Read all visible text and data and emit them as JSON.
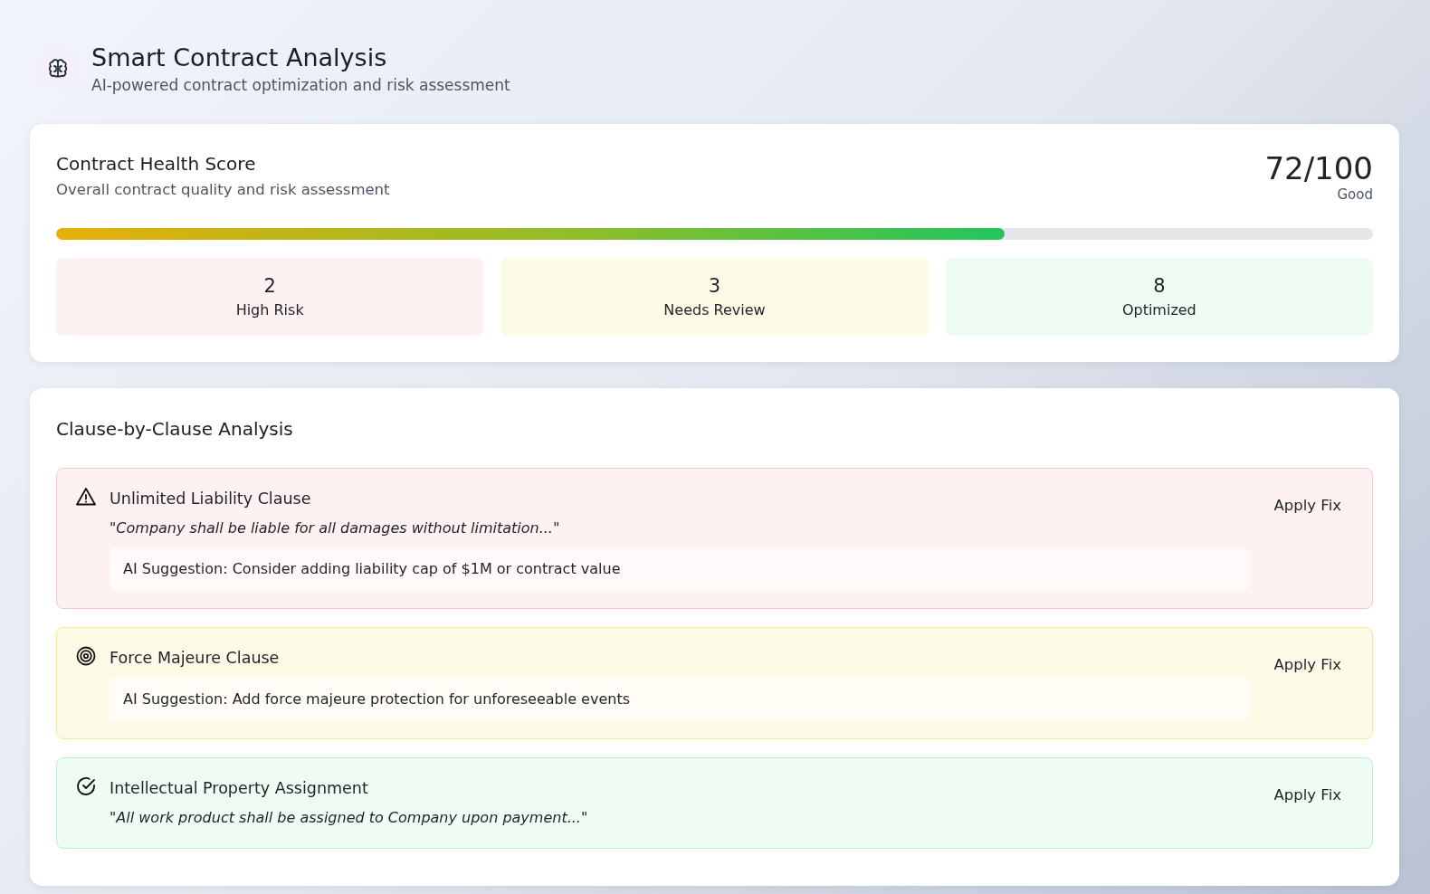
{
  "header": {
    "title": "Smart Contract Analysis",
    "subtitle": "AI-powered contract optimization and risk assessment"
  },
  "health": {
    "title": "Contract Health Score",
    "subtitle": "Overall contract quality and risk assessment",
    "score": "72/100",
    "rating": "Good",
    "level": 0.72,
    "stats": [
      {
        "kind": "risk",
        "value": "2",
        "label": "High Risk"
      },
      {
        "kind": "review",
        "value": "3",
        "label": "Needs Review"
      },
      {
        "kind": "optimized",
        "value": "8",
        "label": "Optimized"
      }
    ]
  },
  "analysis": {
    "title": "Clause-by-Clause Analysis",
    "clauses": [
      {
        "kind": "risk",
        "title": "Unlimited Liability Clause",
        "quote": "\"Company shall be liable for all damages without limitation...\"",
        "suggestion": "AI Suggestion: Consider adding liability cap of $1M or contract value",
        "action": "Apply Fix"
      },
      {
        "kind": "review",
        "title": "Force Majeure Clause",
        "suggestion": "AI Suggestion: Add force majeure protection for unforeseeable events",
        "action": "Apply Fix"
      },
      {
        "kind": "optimized",
        "title": "Intellectual Property Assignment",
        "quote": "\"All work product shall be assigned to Company upon payment...\"",
        "action": "Apply Fix"
      }
    ]
  }
}
